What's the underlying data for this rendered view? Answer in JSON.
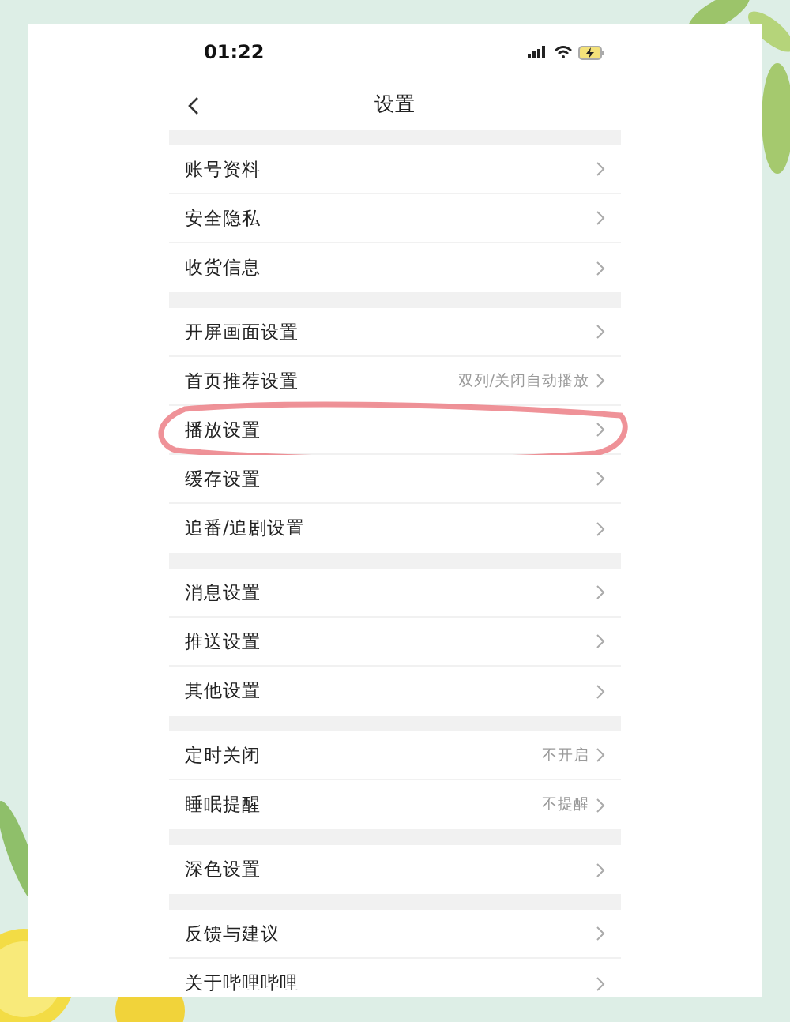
{
  "status_bar": {
    "time": "01:22"
  },
  "nav": {
    "title": "设置"
  },
  "groups": [
    {
      "items": [
        {
          "label": "账号资料",
          "highlighted": false
        },
        {
          "label": "安全隐私",
          "highlighted": false
        },
        {
          "label": "收货信息",
          "highlighted": false
        }
      ]
    },
    {
      "items": [
        {
          "label": "开屏画面设置",
          "highlighted": false
        },
        {
          "label": "首页推荐设置",
          "value": "双列/关闭自动播放",
          "highlighted": false
        },
        {
          "label": "播放设置",
          "highlighted": true
        },
        {
          "label": "缓存设置",
          "highlighted": false
        },
        {
          "label": "追番/追剧设置",
          "highlighted": false
        }
      ]
    },
    {
      "items": [
        {
          "label": "消息设置",
          "highlighted": false
        },
        {
          "label": "推送设置",
          "highlighted": false
        },
        {
          "label": "其他设置",
          "highlighted": false
        }
      ]
    },
    {
      "items": [
        {
          "label": "定时关闭",
          "value": "不开启",
          "highlighted": false
        },
        {
          "label": "睡眠提醒",
          "value": "不提醒",
          "highlighted": false
        }
      ]
    },
    {
      "items": [
        {
          "label": "深色设置",
          "highlighted": false
        }
      ]
    },
    {
      "items": [
        {
          "label": "反馈与建议",
          "highlighted": false
        },
        {
          "label": "关于哔哩哔哩",
          "highlighted": false
        }
      ]
    }
  ]
}
